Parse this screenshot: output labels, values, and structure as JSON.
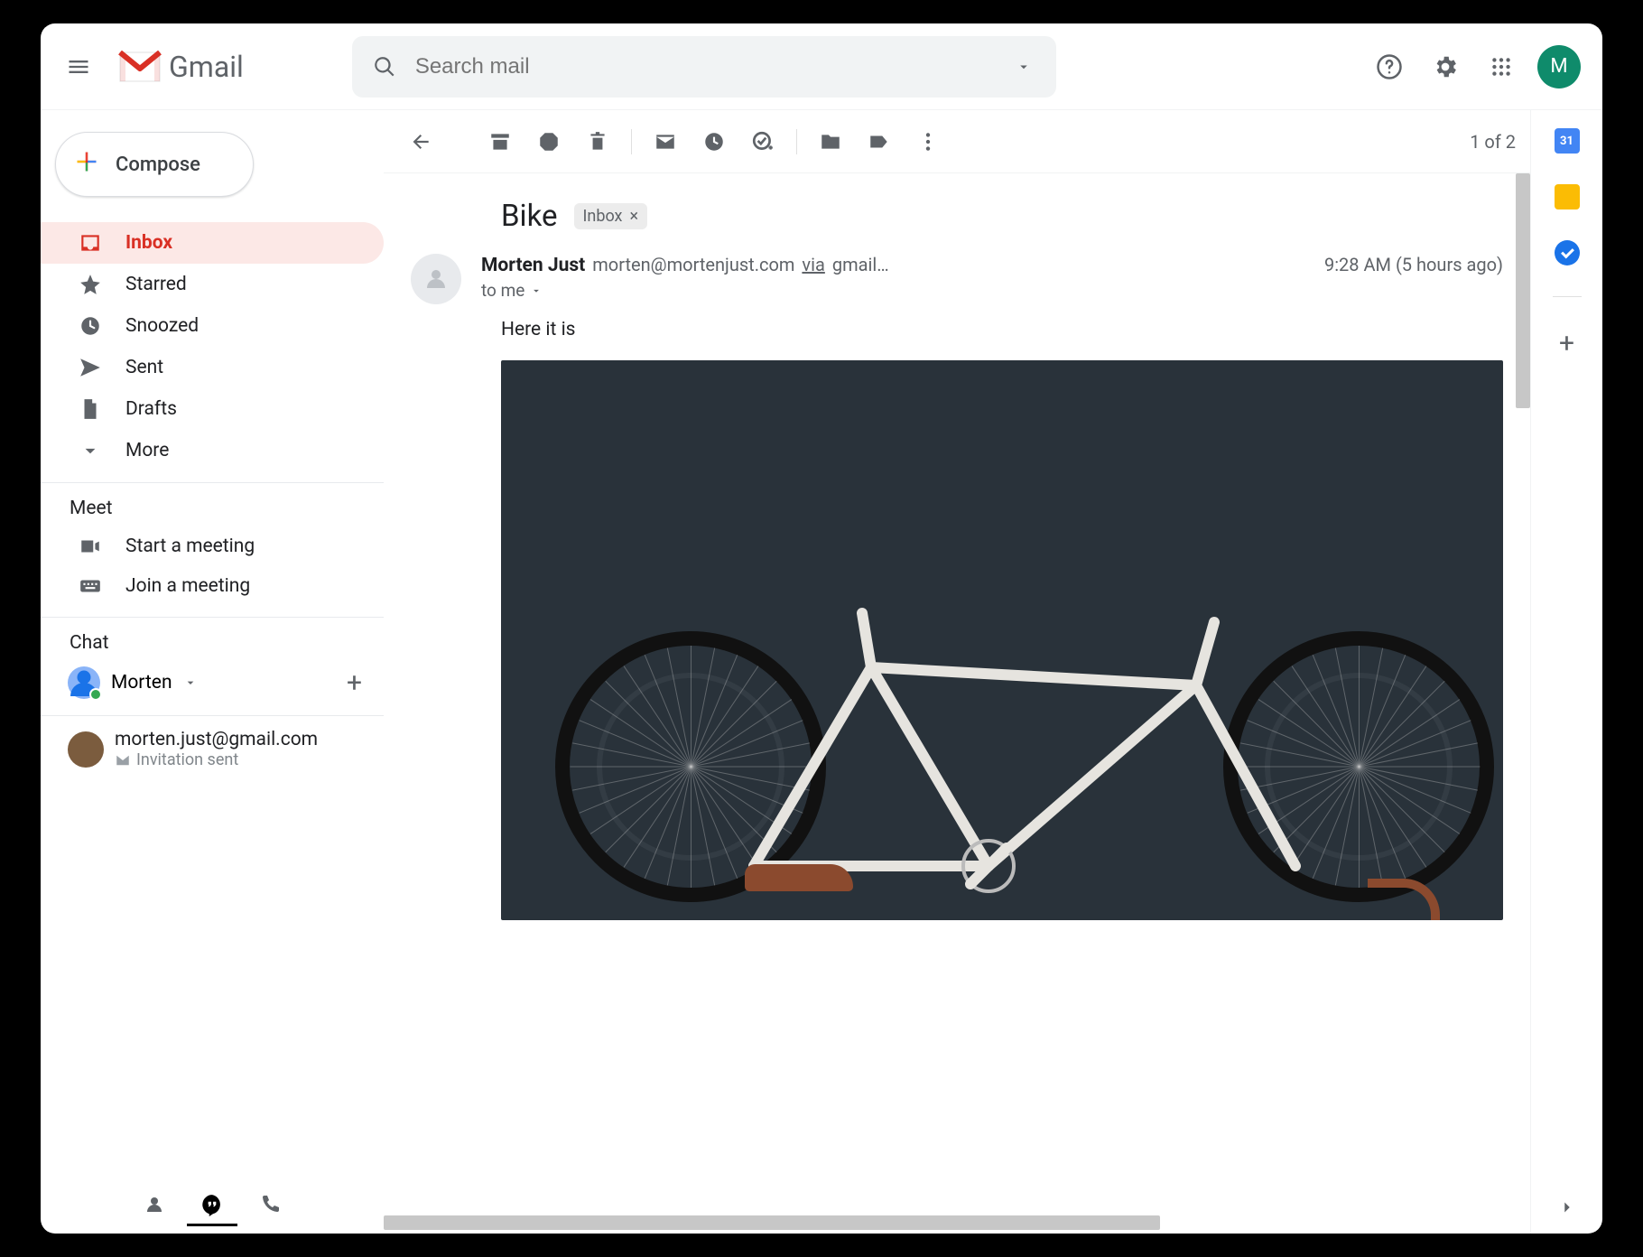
{
  "header": {
    "app_name": "Gmail",
    "search_placeholder": "Search mail",
    "avatar_initial": "M"
  },
  "sidebar": {
    "compose": "Compose",
    "nav": [
      {
        "icon": "inbox",
        "label": "Inbox",
        "active": true
      },
      {
        "icon": "star",
        "label": "Starred"
      },
      {
        "icon": "clock",
        "label": "Snoozed"
      },
      {
        "icon": "send",
        "label": "Sent"
      },
      {
        "icon": "file",
        "label": "Drafts"
      },
      {
        "icon": "chevron",
        "label": "More"
      }
    ],
    "meet_title": "Meet",
    "meet": [
      {
        "icon": "video",
        "label": "Start a meeting"
      },
      {
        "icon": "keyboard",
        "label": "Join a meeting"
      }
    ],
    "chat_title": "Chat",
    "chat_user": "Morten",
    "contact_email": "morten.just@gmail.com",
    "contact_sub": "Invitation sent"
  },
  "toolbar": {
    "pager": "1 of 2"
  },
  "thread": {
    "subject": "Bike",
    "label": "Inbox",
    "sender_name": "Morten Just",
    "sender_email": "morten@mortenjust.com",
    "via": "via",
    "via_domain": "gmail…",
    "to": "to me",
    "time": "9:28 AM (5 hours ago)",
    "body": "Here it is"
  },
  "sidepanel": {
    "cal_day": "31"
  }
}
